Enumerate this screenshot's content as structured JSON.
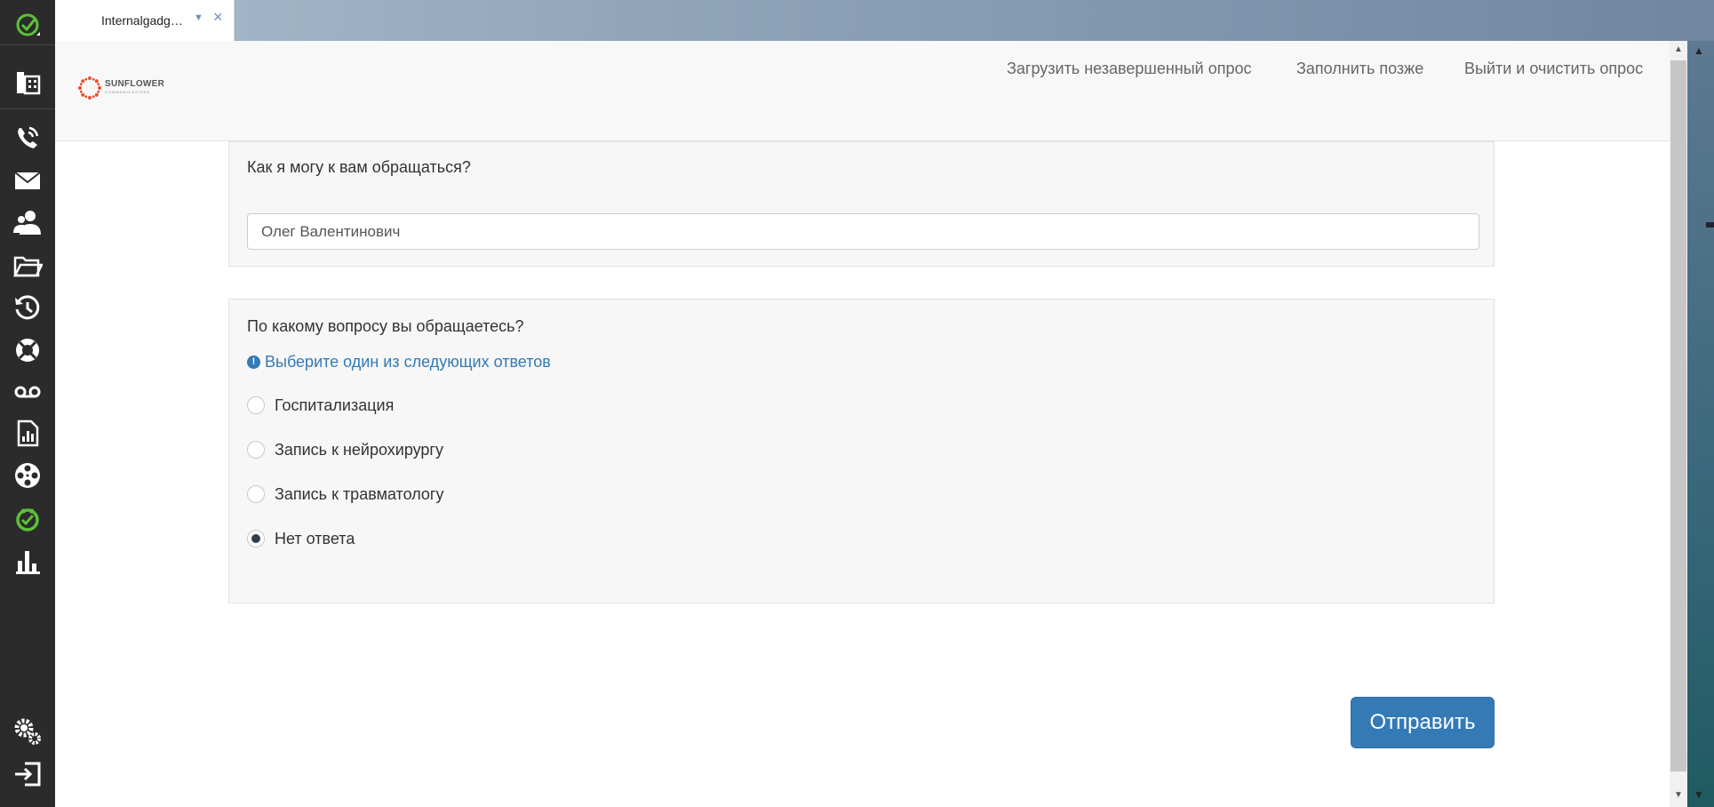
{
  "tab": {
    "label": "Internalgadg…",
    "dropdown_icon": "chevron-down-icon",
    "close_icon": "close-icon"
  },
  "sidebar": {
    "items": [
      {
        "name": "status-check-icon"
      },
      {
        "name": "office-building-icon"
      },
      {
        "name": "phone-call-icon"
      },
      {
        "name": "envelope-icon"
      },
      {
        "name": "contacts-icon"
      },
      {
        "name": "folder-open-icon"
      },
      {
        "name": "history-icon"
      },
      {
        "name": "lifebuoy-icon"
      },
      {
        "name": "voicemail-icon"
      },
      {
        "name": "report-icon"
      },
      {
        "name": "film-reel-icon"
      },
      {
        "name": "survey-icon",
        "active": true
      },
      {
        "name": "bar-chart-icon"
      },
      {
        "name": "settings-gears-icon"
      },
      {
        "name": "logout-icon"
      }
    ],
    "colors": {
      "background": "#2b2b2b",
      "icon": "#ffffff",
      "active": "#5bc236"
    }
  },
  "header": {
    "logo_text": "SUNFLOWER",
    "logo_subtext": "COMMUNICATIONS",
    "links": {
      "load": "Загрузить незавершенный опрос",
      "later": "Заполнить позже",
      "exit": "Выйти и очистить опрос"
    }
  },
  "question1": {
    "title": "Как я могу к вам обращаться?",
    "value": "Олег Валентинович"
  },
  "question2": {
    "title": "По какому вопросу вы обращаетесь?",
    "hint": "Выберите один из следующих ответов",
    "options": [
      {
        "label": "Госпитализация",
        "checked": false
      },
      {
        "label": "Запись к нейрохирургу",
        "checked": false
      },
      {
        "label": "Запись к травматологу",
        "checked": false
      },
      {
        "label": "Нет ответа",
        "checked": true
      }
    ]
  },
  "submit_label": "Отправить",
  "colors": {
    "accent": "#337ab7",
    "hint": "#337ab7"
  }
}
